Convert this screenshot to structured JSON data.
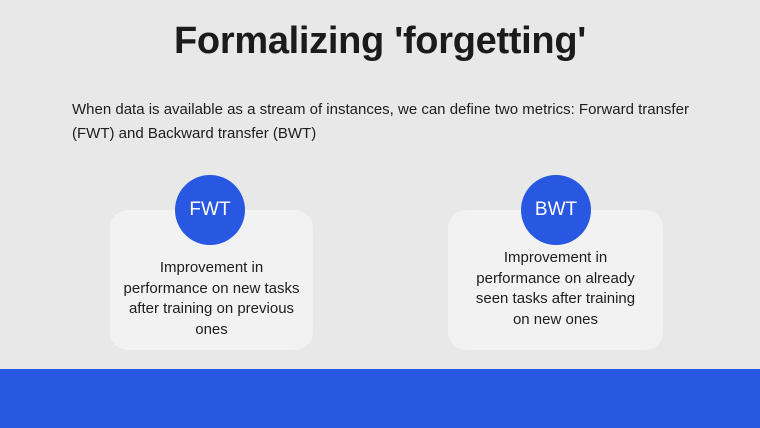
{
  "slide": {
    "title": "Formalizing 'forgetting'",
    "intro": "When data is available as a stream of instances, we can define two metrics: Forward transfer (FWT) and Backward transfer (BWT)"
  },
  "metrics": [
    {
      "label": "FWT",
      "description": "Improvement in performance on new tasks after training on previous ones"
    },
    {
      "label": "BWT",
      "description": "Improvement in performance on already seen tasks after training on new ones"
    }
  ],
  "colors": {
    "accent": "#2857e2",
    "background": "#e8e8e8",
    "card": "#f2f2f2"
  }
}
